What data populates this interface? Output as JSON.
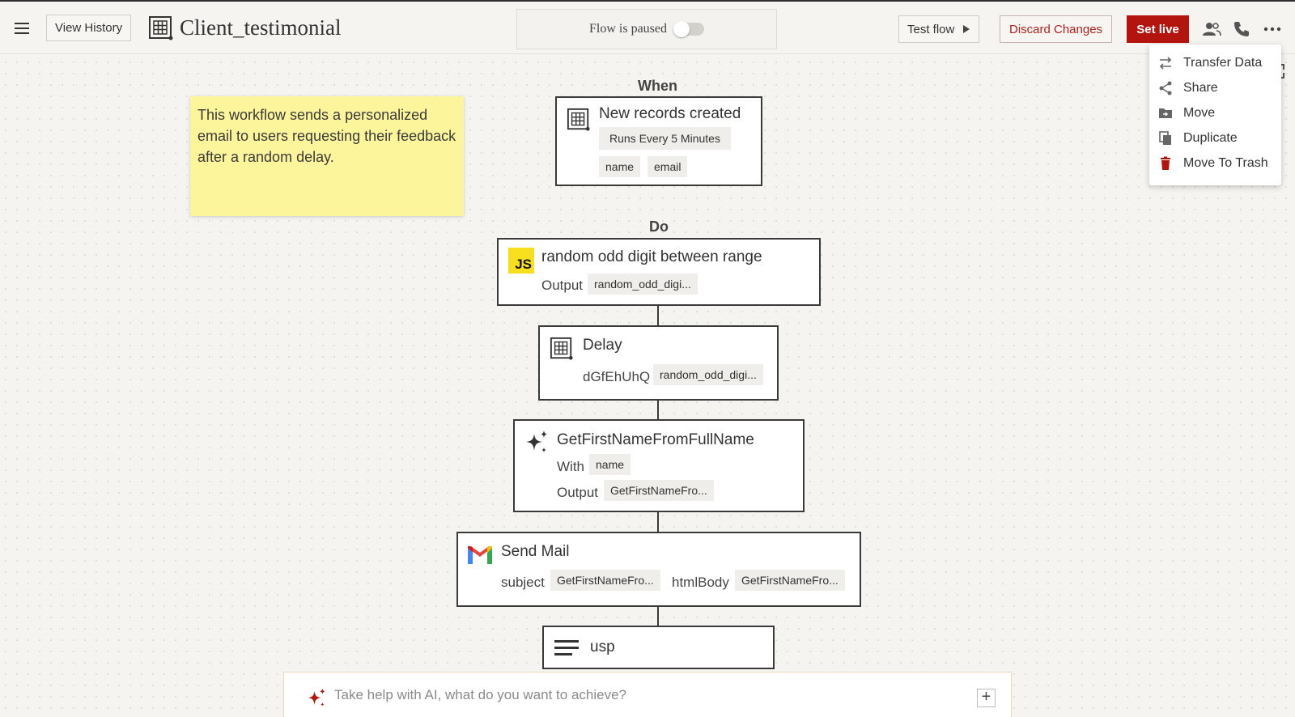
{
  "header": {
    "view_history": "View History",
    "title": "Client_testimonial",
    "pause_label": "Flow is paused",
    "test_flow": "Test flow",
    "discard": "Discard Changes",
    "set_live": "Set live"
  },
  "menu": {
    "items": [
      {
        "label": "Transfer Data",
        "icon": "transfer-icon"
      },
      {
        "label": "Share",
        "icon": "share-icon"
      },
      {
        "label": "Move",
        "icon": "folder-move-icon"
      },
      {
        "label": "Duplicate",
        "icon": "duplicate-icon"
      },
      {
        "label": "Move To Trash",
        "icon": "trash-icon"
      }
    ]
  },
  "note": "This workflow sends a personalized email to users requesting their feedback after a random delay.",
  "when": {
    "label": "When",
    "title": "New records created",
    "schedule": "Runs Every 5 Minutes",
    "fields": [
      "name",
      "email"
    ]
  },
  "do_label": "Do",
  "steps": {
    "random": {
      "title": "random odd digit between range",
      "output_label": "Output",
      "output": "random_odd_digi..."
    },
    "delay": {
      "title": "Delay",
      "param_label": "dGfEhUhQ",
      "param": "random_odd_digi..."
    },
    "getfirst": {
      "title": "GetFirstNameFromFullName",
      "with_label": "With",
      "with": "name",
      "output_label": "Output",
      "output": "GetFirstNameFro..."
    },
    "sendmail": {
      "title": "Send Mail",
      "subject_label": "subject",
      "subject": "GetFirstNameFro...",
      "body_label": "htmlBody",
      "body": "GetFirstNameFro..."
    },
    "usp": {
      "title": "usp"
    }
  },
  "ai": {
    "placeholder": "Take help with AI, what do you want to achieve?"
  },
  "colors": {
    "accent": "#b3150e",
    "note": "#fdf59b",
    "js": "#f7df1e"
  }
}
